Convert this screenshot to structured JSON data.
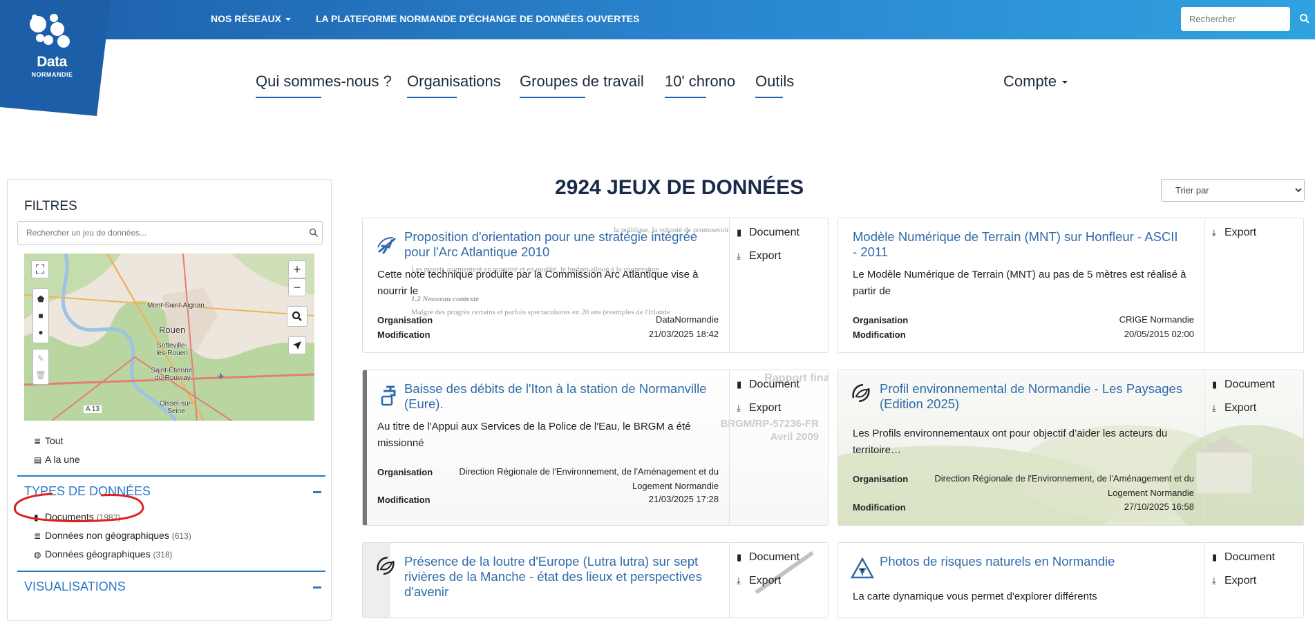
{
  "header": {
    "nav_networks": "NOS RÉSEAUX",
    "platform_label": "LA PLATEFORME NORMANDE D'ÉCHANGE DE DONNÉES OUVERTES",
    "search_placeholder": "Rechercher",
    "logo_title": "Data",
    "logo_subtitle": "NORMANDIE"
  },
  "main_nav": {
    "items": [
      {
        "label": "Qui sommes-nous ?"
      },
      {
        "label": "Organisations"
      },
      {
        "label": "Groupes de travail"
      },
      {
        "label": "10' chrono"
      },
      {
        "label": "Outils"
      }
    ],
    "account": "Compte"
  },
  "sidebar": {
    "title": "FILTRES",
    "search_placeholder": "Rechercher un jeu de données...",
    "map_labels": [
      "Mont-Saint-Aignan",
      "Rouen",
      "Sotteville-lès-Rouen",
      "Saint-Étienne-du-Rouvray",
      "Oissel-sur-Seine",
      "A 13"
    ],
    "quick_links": [
      {
        "label": "Tout",
        "icon": "database-icon"
      },
      {
        "label": "A la une",
        "icon": "newspaper-icon"
      }
    ],
    "types_title": "TYPES DE DONNÉES",
    "types": [
      {
        "label": "Documents",
        "count": "(1982)",
        "icon": "file-icon"
      },
      {
        "label": "Données non géographiques",
        "count": "(613)",
        "icon": "database-icon"
      },
      {
        "label": "Données géographiques",
        "count": "(318)",
        "icon": "globe-icon"
      }
    ],
    "visualisations_title": "VISUALISATIONS"
  },
  "content": {
    "count_title": "2924 JEUX DE DONNÉES",
    "sort_label": "Trier par",
    "actions": {
      "document": "Document",
      "export": "Export"
    },
    "meta_labels": {
      "organisation": "Organisation",
      "modification": "Modification"
    },
    "cards": [
      {
        "title": "Proposition d'orientation pour une stratégie intégrée pour l'Arc Atlantique 2010",
        "description": "Cette note technique produite par la Commission Arc Atlantique vise à nourrir le",
        "organisation": "DataNormandie",
        "modification": "21/03/2025 18:42",
        "icon": "plane-icon"
      },
      {
        "title": "Modèle Numérique de Terrain (MNT) sur Honfleur - ASCII - 2011",
        "description": "Le Modèle Numérique de Terrain (MNT) au pas de 5 mètres est réalisé à partir de",
        "organisation": "CRIGE Normandie",
        "modification": "20/05/2015 02:00"
      },
      {
        "title": "Baisse des débits de l'Iton à la station de Normanville (Eure).",
        "description": "Au titre de l'Appui aux Services de la Police de l'Eau, le BRGM a été missionné",
        "organisation": "Direction Régionale de l'Environnement, de l'Aménagement et du Logement Normandie",
        "modification": "21/03/2025 17:28",
        "icon": "water-tap-icon"
      },
      {
        "title": "Profil environnemental de Normandie - Les Paysages (Edition 2025)",
        "description": "Les Profils environnementaux ont pour objectif d’aider les acteurs du territoire…",
        "organisation": "Direction Régionale de l'Environnement, de l'Aménagement et du Logement Normandie",
        "modification": "27/10/2025 16:58",
        "icon": "recycle-leaf-icon"
      },
      {
        "title": "Présence de la loutre d'Europe (Lutra lutra) sur sept rivières de la Manche - état des lieux et perspectives d'avenir",
        "icon": "recycle-leaf-icon"
      },
      {
        "title": "Photos de risques naturels en Normandie",
        "description": "La carte dynamique vous permet d'explorer différents",
        "icon": "hazard-icon"
      }
    ],
    "card1_bg_text": [
      "Proposition d'orientation",
      "la politique, la volonté de promouvoir",
      "Les projets augmentent en quantité et en qualité, le budget alloué à la coopération",
      "1.2 Nouveau contexte",
      "Malgré des progrès certains et parfois spectaculaires en 20 ans (exemples de l'Irlande"
    ],
    "card3_bg_text": [
      "Rapport final",
      "BRGM/RP-57236-FR",
      "Avril 2009"
    ]
  }
}
